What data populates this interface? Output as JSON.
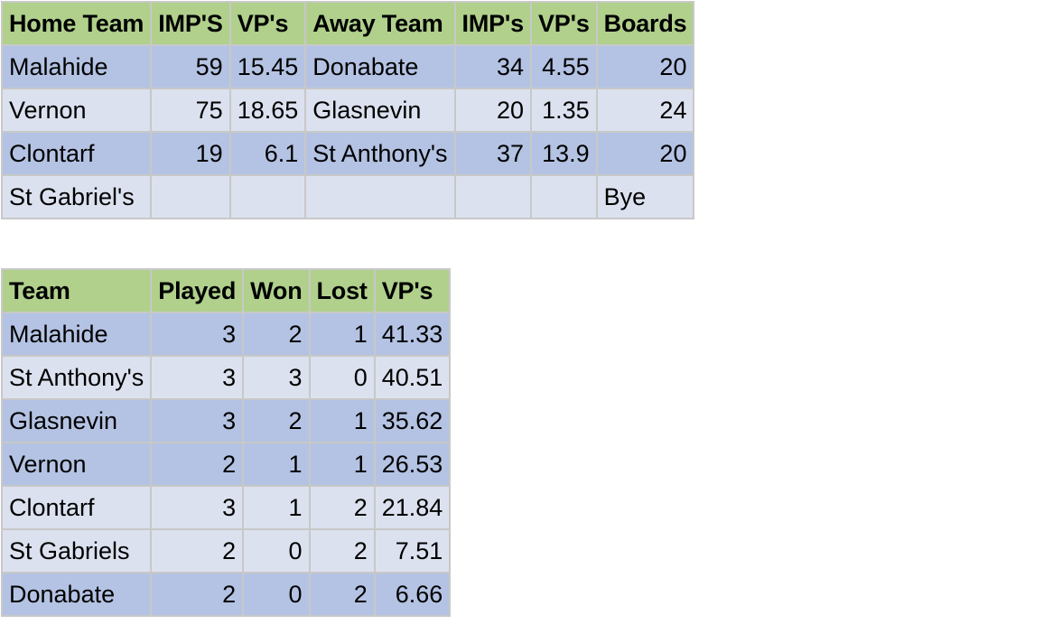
{
  "colors": {
    "header_green": "#b0d08c",
    "row_dark": "#b4c3e3",
    "row_light": "#dce1ef",
    "grid_line": "#c8c8c8",
    "background": "#ffffff",
    "text": "#000000"
  },
  "results": {
    "name": "match-results",
    "headers": [
      "Home Team",
      "IMP'S",
      "VP's",
      "Away Team",
      "IMP's",
      "VP's",
      "Boards"
    ],
    "rows": [
      {
        "band": "dark",
        "cells": [
          "Malahide",
          "59",
          "15.45",
          "Donabate",
          "34",
          "4.55",
          "20"
        ],
        "align": [
          "txt",
          "num",
          "num",
          "txt",
          "num",
          "num",
          "num"
        ]
      },
      {
        "band": "light",
        "cells": [
          "Vernon",
          "75",
          "18.65",
          "Glasnevin",
          "20",
          "1.35",
          "24"
        ],
        "align": [
          "txt",
          "num",
          "num",
          "txt",
          "num",
          "num",
          "num"
        ]
      },
      {
        "band": "dark",
        "cells": [
          "Clontarf",
          "19",
          "6.1",
          "St Anthony's",
          "37",
          "13.9",
          "20"
        ],
        "align": [
          "txt",
          "num",
          "num",
          "txt",
          "num",
          "num",
          "num"
        ]
      },
      {
        "band": "light",
        "cells": [
          "St Gabriel's",
          "",
          "",
          "",
          "",
          "",
          "Bye"
        ],
        "align": [
          "txt",
          "num",
          "num",
          "txt",
          "num",
          "num",
          "txt"
        ]
      }
    ]
  },
  "standings": {
    "name": "league-standings",
    "headers": [
      "Team",
      "Played",
      "Won",
      "Lost",
      "VP's"
    ],
    "rows": [
      {
        "band": "dark",
        "cells": [
          "Malahide",
          "3",
          "2",
          "1",
          "41.33"
        ],
        "align": [
          "txt",
          "num",
          "num",
          "num",
          "num"
        ]
      },
      {
        "band": "light",
        "cells": [
          "St Anthony's",
          "3",
          "3",
          "0",
          "40.51"
        ],
        "align": [
          "txt",
          "num",
          "num",
          "num",
          "num"
        ]
      },
      {
        "band": "dark",
        "cells": [
          "Glasnevin",
          "3",
          "2",
          "1",
          "35.62"
        ],
        "align": [
          "txt",
          "num",
          "num",
          "num",
          "num"
        ]
      },
      {
        "band": "dark",
        "cells": [
          "Vernon",
          "2",
          "1",
          "1",
          "26.53"
        ],
        "align": [
          "txt",
          "num",
          "num",
          "num",
          "num"
        ]
      },
      {
        "band": "light",
        "cells": [
          "Clontarf",
          "3",
          "1",
          "2",
          "21.84"
        ],
        "align": [
          "txt",
          "num",
          "num",
          "num",
          "num"
        ]
      },
      {
        "band": "light",
        "cells": [
          "St Gabriels",
          "2",
          "0",
          "2",
          "7.51"
        ],
        "align": [
          "txt",
          "num",
          "num",
          "num",
          "num"
        ]
      },
      {
        "band": "dark",
        "cells": [
          "Donabate",
          "2",
          "0",
          "2",
          "6.66"
        ],
        "align": [
          "txt",
          "num",
          "num",
          "num",
          "num"
        ]
      }
    ]
  }
}
